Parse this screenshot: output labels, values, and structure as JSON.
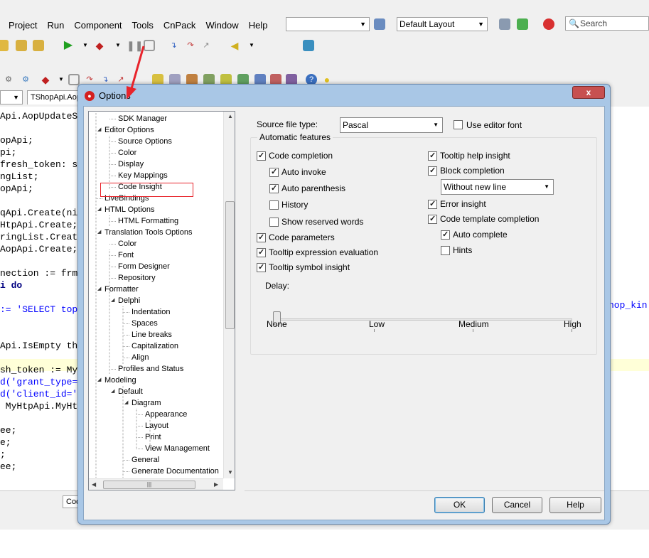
{
  "ide": {
    "menu": [
      "Project",
      "Run",
      "Component",
      "Tools",
      "CnPack",
      "Window",
      "Help"
    ],
    "layout_combo": "Default Layout",
    "search_placeholder": "Search",
    "file_tab": "TShopApi.Aop",
    "bottom_tab": "Cod",
    "code_lines": [
      {
        "text": "Api.AopUpdateS",
        "kind": "plain"
      },
      {
        "text": "",
        "kind": "plain"
      },
      {
        "text": "opApi;",
        "kind": "plain"
      },
      {
        "text": "pi;",
        "kind": "plain"
      },
      {
        "text": "fresh_token: s",
        "kind": "plain"
      },
      {
        "text": "ngList;",
        "kind": "plain"
      },
      {
        "text": "opApi;",
        "kind": "plain"
      },
      {
        "text": "",
        "kind": "plain"
      },
      {
        "text": "qApi.Create(ni",
        "kind": "plain"
      },
      {
        "text": "HtpApi.Create;",
        "kind": "plain"
      },
      {
        "text": "ringList.Creat",
        "kind": "plain"
      },
      {
        "text": "AopApi.Create;",
        "kind": "plain"
      },
      {
        "text": "",
        "kind": "plain"
      },
      {
        "text": "nection := frm",
        "kind": "plain"
      },
      {
        "text": "i do",
        "kind": "kw"
      },
      {
        "text": "",
        "kind": "plain"
      },
      {
        "text": ":= 'SELECT top",
        "kind": "str"
      },
      {
        "text": "",
        "kind": "plain"
      },
      {
        "text": "",
        "kind": "plain"
      },
      {
        "text": "Api.IsEmpty th",
        "kind": "plain"
      },
      {
        "text": "",
        "kind": "plain"
      },
      {
        "text": "sh_token := My",
        "kind": "plain"
      },
      {
        "text": "d('grant_type=",
        "kind": "str"
      },
      {
        "text": "d('client_id='",
        "kind": "str"
      },
      {
        "text": " MyHtpApi.MyHt",
        "kind": "plain"
      },
      {
        "text": "",
        "kind": "plain"
      },
      {
        "text": "ee;",
        "kind": "plain"
      },
      {
        "text": "e;",
        "kind": "plain"
      },
      {
        "text": ";",
        "kind": "plain"
      },
      {
        "text": "ee;",
        "kind": "plain"
      }
    ],
    "code_right_fragment": "hop_kin"
  },
  "dialog": {
    "title": "Options",
    "close_label": "x",
    "tree": [
      {
        "label": "SDK Manager",
        "level": 1,
        "exp": ""
      },
      {
        "label": "Editor Options",
        "level": 0,
        "exp": "open"
      },
      {
        "label": "Source Options",
        "level": 1,
        "exp": ""
      },
      {
        "label": "Color",
        "level": 1,
        "exp": ""
      },
      {
        "label": "Display",
        "level": 1,
        "exp": ""
      },
      {
        "label": "Key Mappings",
        "level": 1,
        "exp": ""
      },
      {
        "label": "Code Insight",
        "level": 1,
        "exp": "",
        "selected": true
      },
      {
        "label": "LiveBindings",
        "level": 0,
        "exp": ""
      },
      {
        "label": "HTML Options",
        "level": 0,
        "exp": "open"
      },
      {
        "label": "HTML Formatting",
        "level": 1,
        "exp": ""
      },
      {
        "label": "Translation Tools Options",
        "level": 0,
        "exp": "open"
      },
      {
        "label": "Color",
        "level": 1,
        "exp": ""
      },
      {
        "label": "Font",
        "level": 1,
        "exp": ""
      },
      {
        "label": "Form Designer",
        "level": 1,
        "exp": ""
      },
      {
        "label": "Repository",
        "level": 1,
        "exp": ""
      },
      {
        "label": "Formatter",
        "level": 0,
        "exp": "open"
      },
      {
        "label": "Delphi",
        "level": 1,
        "exp": "open"
      },
      {
        "label": "Indentation",
        "level": 2,
        "exp": ""
      },
      {
        "label": "Spaces",
        "level": 2,
        "exp": ""
      },
      {
        "label": "Line breaks",
        "level": 2,
        "exp": ""
      },
      {
        "label": "Capitalization",
        "level": 2,
        "exp": ""
      },
      {
        "label": "Align",
        "level": 2,
        "exp": ""
      },
      {
        "label": "Profiles and Status",
        "level": 1,
        "exp": ""
      },
      {
        "label": "Modeling",
        "level": 0,
        "exp": "open"
      },
      {
        "label": "Default",
        "level": 1,
        "exp": "open"
      },
      {
        "label": "Diagram",
        "level": 2,
        "exp": "open"
      },
      {
        "label": "Appearance",
        "level": 3,
        "exp": ""
      },
      {
        "label": "Layout",
        "level": 3,
        "exp": ""
      },
      {
        "label": "Print",
        "level": 3,
        "exp": ""
      },
      {
        "label": "View Management",
        "level": 3,
        "exp": ""
      },
      {
        "label": "General",
        "level": 2,
        "exp": ""
      },
      {
        "label": "Generate Documentation",
        "level": 2,
        "exp": ""
      }
    ],
    "source_file_type_label": "Source file type:",
    "source_file_type_value": "Pascal",
    "use_editor_font": {
      "label": "Use editor font",
      "checked": false
    },
    "automatic_features_label": "Automatic features",
    "left_options": [
      {
        "key": "code_completion",
        "label": "Code completion",
        "checked": true
      },
      {
        "key": "auto_invoke",
        "label": "Auto invoke",
        "checked": true
      },
      {
        "key": "auto_parenthesis",
        "label": "Auto parenthesis",
        "checked": true
      },
      {
        "key": "history",
        "label": "History",
        "checked": false
      },
      {
        "key": "show_reserved_words",
        "label": "Show reserved words",
        "checked": false
      },
      {
        "key": "code_parameters",
        "label": "Code parameters",
        "checked": true
      },
      {
        "key": "tooltip_expression_evaluation",
        "label": "Tooltip expression evaluation",
        "checked": true
      },
      {
        "key": "tooltip_symbol_insight",
        "label": "Tooltip symbol insight",
        "checked": true
      }
    ],
    "right_options": [
      {
        "key": "tooltip_help_insight",
        "label": "Tooltip help insight",
        "checked": true
      },
      {
        "key": "block_completion",
        "label": "Block completion",
        "checked": true
      },
      {
        "key": "error_insight",
        "label": "Error insight",
        "checked": true
      },
      {
        "key": "code_template_completion",
        "label": "Code template completion",
        "checked": true
      },
      {
        "key": "auto_complete",
        "label": "Auto complete",
        "checked": true
      },
      {
        "key": "hints",
        "label": "Hints",
        "checked": false
      }
    ],
    "block_completion_value": "Without new line",
    "delay_label": "Delay:",
    "delay_ticks": [
      "None",
      "Low",
      "Medium",
      "High"
    ],
    "delay_value": "None",
    "buttons": {
      "ok": "OK",
      "cancel": "Cancel",
      "help": "Help"
    }
  },
  "colors": {
    "annotation_red": "#e8232b",
    "dialog_frame": "#a9c7e6"
  }
}
